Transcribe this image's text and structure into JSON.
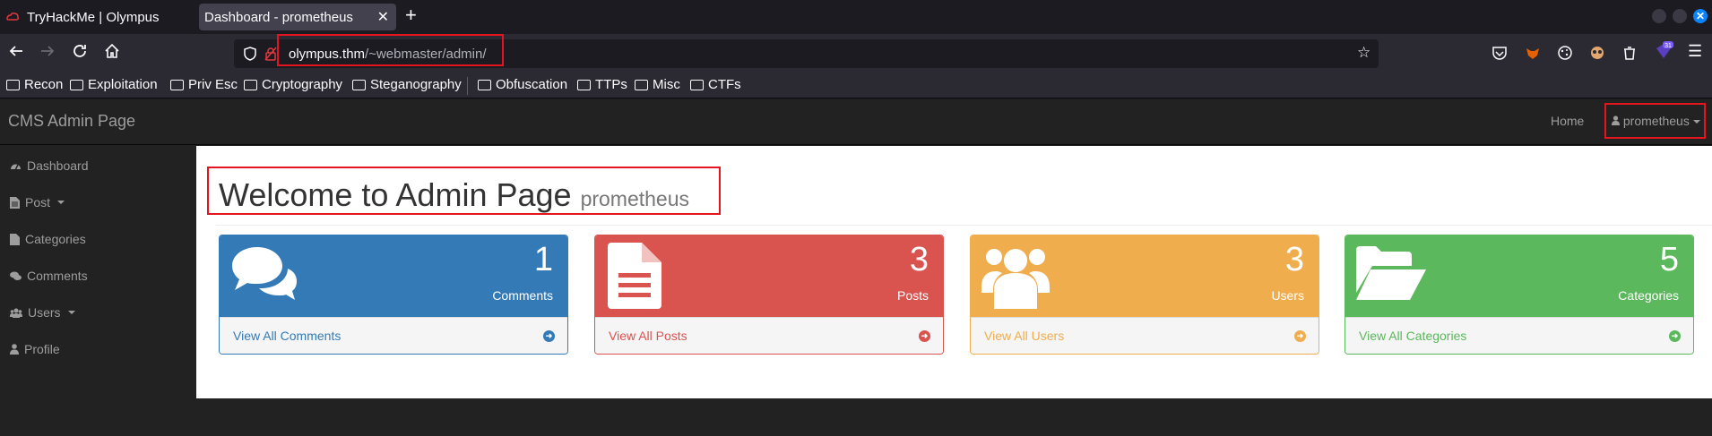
{
  "browser": {
    "tabs": [
      {
        "title": "TryHackMe | Olympus",
        "active": false
      },
      {
        "title": "Dashboard - prometheus",
        "active": true
      }
    ],
    "url": {
      "host": "olympus.thm",
      "path": "/~webmaster/admin/"
    },
    "bookmarks": [
      "Recon",
      "Exploitation",
      "Priv Esc",
      "Cryptography",
      "Steganography",
      "Obfuscation",
      "TTPs",
      "Misc",
      "CTFs"
    ],
    "extension_badge": "31"
  },
  "app": {
    "brand": "CMS Admin Page",
    "nav": {
      "home": "Home",
      "user": "prometheus"
    },
    "sidebar": [
      {
        "label": "Dashboard",
        "icon": "dashboard-icon"
      },
      {
        "label": "Post",
        "icon": "file-icon",
        "dropdown": true
      },
      {
        "label": "Categories",
        "icon": "file-icon"
      },
      {
        "label": "Comments",
        "icon": "comments-icon"
      },
      {
        "label": "Users",
        "icon": "users-icon",
        "dropdown": true
      },
      {
        "label": "Profile",
        "icon": "user-icon"
      }
    ],
    "page": {
      "title": "Welcome to Admin Page",
      "subtitle": "prometheus"
    },
    "panels": [
      {
        "count": "1",
        "label": "Comments",
        "link": "View All Comments",
        "color": "#337ab7",
        "icon": "comments-icon"
      },
      {
        "count": "3",
        "label": "Posts",
        "link": "View All Posts",
        "color": "#d9534f",
        "icon": "file-text-icon"
      },
      {
        "count": "3",
        "label": "Users",
        "link": "View All Users",
        "color": "#f0ad4e",
        "icon": "users-icon"
      },
      {
        "count": "5",
        "label": "Categories",
        "link": "View All Categories",
        "color": "#5cb85c",
        "icon": "folder-open-icon"
      }
    ]
  }
}
